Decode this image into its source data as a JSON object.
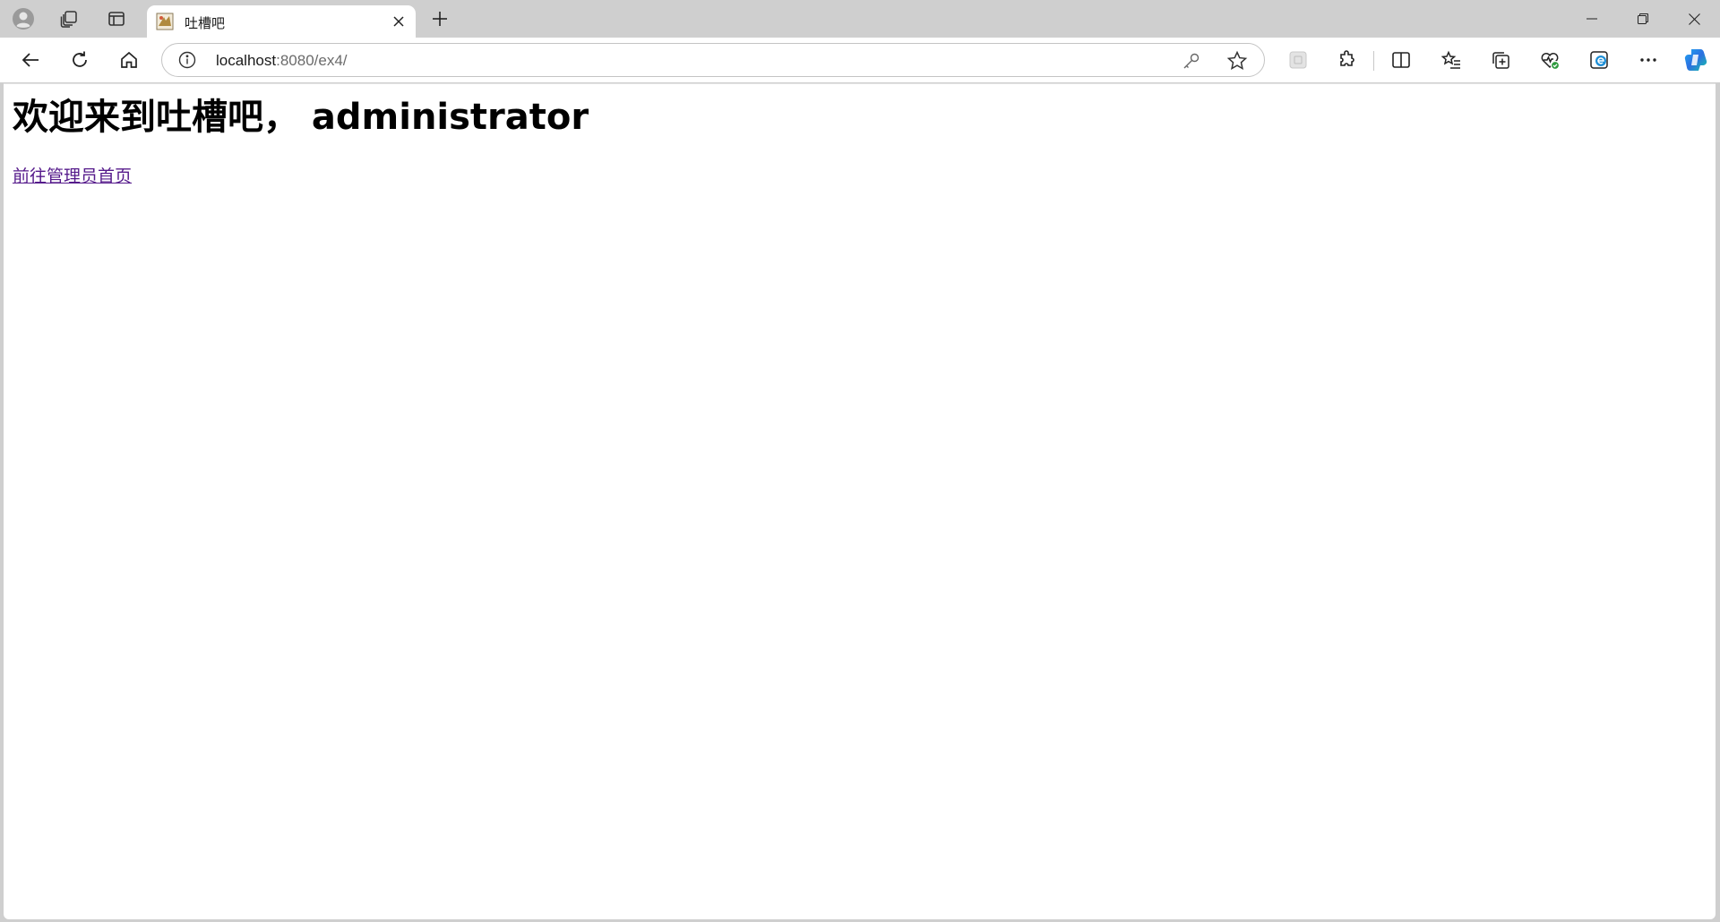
{
  "tab": {
    "title": "吐槽吧",
    "favicon": "page-favicon"
  },
  "address_bar": {
    "host": "localhost",
    "rest": ":8080/ex4/"
  },
  "page": {
    "heading": "欢迎来到吐槽吧， administrator",
    "link_label": "前往管理员首页"
  },
  "colors": {
    "link_visited": "#551a8b",
    "tabstrip_bg": "#cfcfcf"
  },
  "icons": {
    "profile": "profile-avatar-icon",
    "workspaces": "workspaces-icon",
    "tab_actions": "vertical-tabs-icon",
    "close_tab": "close-icon",
    "new_tab": "plus-icon",
    "minimize": "minimize-icon",
    "restore": "restore-icon",
    "close_window": "close-icon",
    "back": "back-arrow-icon",
    "refresh": "refresh-icon",
    "home": "home-icon",
    "site_info": "info-icon",
    "password": "key-icon",
    "favorite": "star-icon",
    "reader": "immersive-reader-icon",
    "extensions": "puzzle-icon",
    "split_screen": "split-screen-icon",
    "favorites_list": "favorites-icon",
    "collections": "collections-icon",
    "browser_essentials": "heart-pulse-icon",
    "edge_bar": "edge-icon",
    "more": "ellipsis-icon",
    "copilot": "copilot-icon"
  }
}
